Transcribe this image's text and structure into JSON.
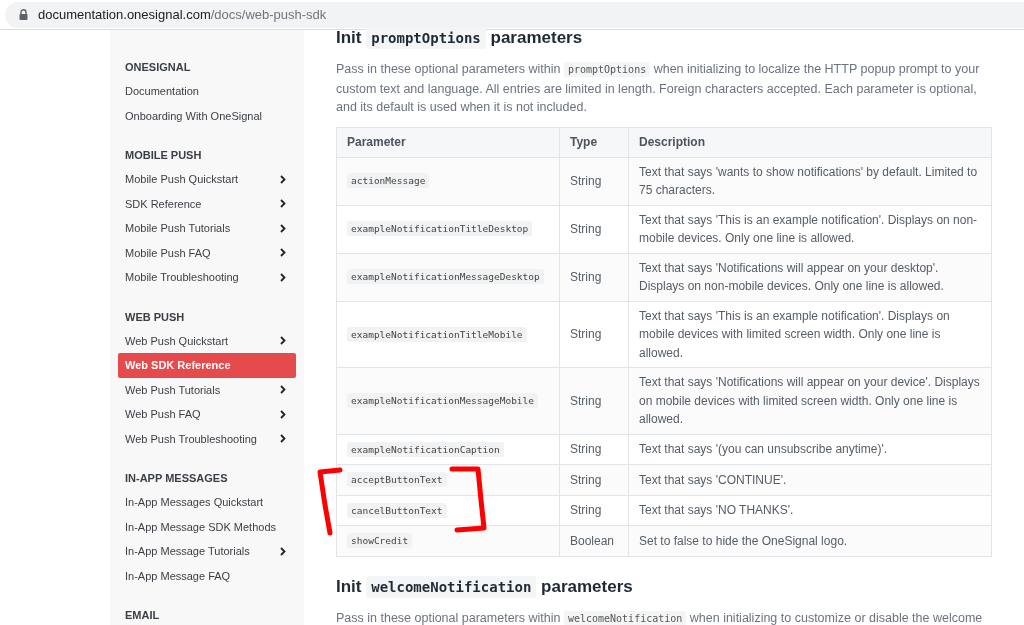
{
  "browser": {
    "url_host": "documentation.onesignal.com",
    "url_path": "/docs/web-push-sdk"
  },
  "sidebar": {
    "groups": [
      {
        "title": "ONESIGNAL",
        "items": [
          {
            "label": "Documentation",
            "has_submenu": false,
            "selected": false
          },
          {
            "label": "Onboarding With OneSignal",
            "has_submenu": false,
            "selected": false
          }
        ]
      },
      {
        "title": "MOBILE PUSH",
        "items": [
          {
            "label": "Mobile Push Quickstart",
            "has_submenu": true,
            "selected": false
          },
          {
            "label": "SDK Reference",
            "has_submenu": true,
            "selected": false
          },
          {
            "label": "Mobile Push Tutorials",
            "has_submenu": true,
            "selected": false
          },
          {
            "label": "Mobile Push FAQ",
            "has_submenu": true,
            "selected": false
          },
          {
            "label": "Mobile Troubleshooting",
            "has_submenu": true,
            "selected": false
          }
        ]
      },
      {
        "title": "WEB PUSH",
        "items": [
          {
            "label": "Web Push Quickstart",
            "has_submenu": true,
            "selected": false
          },
          {
            "label": "Web SDK Reference",
            "has_submenu": false,
            "selected": true
          },
          {
            "label": "Web Push Tutorials",
            "has_submenu": true,
            "selected": false
          },
          {
            "label": "Web Push FAQ",
            "has_submenu": true,
            "selected": false
          },
          {
            "label": "Web Push Troubleshooting",
            "has_submenu": true,
            "selected": false
          }
        ]
      },
      {
        "title": "IN-APP MESSAGES",
        "items": [
          {
            "label": "In-App Messages Quickstart",
            "has_submenu": false,
            "selected": false
          },
          {
            "label": "In-App Message SDK Methods",
            "has_submenu": false,
            "selected": false
          },
          {
            "label": "In-App Message Tutorials",
            "has_submenu": true,
            "selected": false
          },
          {
            "label": "In-App Message FAQ",
            "has_submenu": false,
            "selected": false
          }
        ]
      },
      {
        "title": "EMAIL"
      }
    ]
  },
  "content": {
    "section_1": {
      "heading": {
        "before": "Init",
        "code": "promptOptions",
        "after": "parameters"
      },
      "intro": {
        "before": "Pass in these optional parameters within",
        "code": "promptOptions",
        "after": "when initializing to localize the HTTP popup prompt to your custom text and language. All entries are limited in length. Foreign characters accepted. Each parameter is optional, and its default is used when it is not included."
      },
      "table": {
        "columns": [
          "Parameter",
          "Type",
          "Description"
        ],
        "rows": [
          {
            "parameter": "actionMessage",
            "type": "String",
            "description": "Text that says 'wants to show notifications' by default. Limited to 75 characters."
          },
          {
            "parameter": "exampleNotificationTitleDesktop",
            "type": "String",
            "description": "Text that says 'This is an example notification'. Displays on non-mobile devices. Only one line is allowed."
          },
          {
            "parameter": "exampleNotificationMessageDesktop",
            "type": "String",
            "description": "Text that says 'Notifications will appear on your desktop'. Displays on non-mobile devices. Only one line is allowed."
          },
          {
            "parameter": "exampleNotificationTitleMobile",
            "type": "String",
            "description": "Text that says 'This is an example notification'. Displays on mobile devices with limited screen width. Only one line is allowed."
          },
          {
            "parameter": "exampleNotificationMessageMobile",
            "type": "String",
            "description": "Text that says 'Notifications will appear on your device'. Displays on mobile devices with limited screen width. Only one line is allowed."
          },
          {
            "parameter": "exampleNotificationCaption",
            "type": "String",
            "description": "Text that says '(you can unsubscribe anytime)'."
          },
          {
            "parameter": "acceptButtonText",
            "type": "String",
            "description": "Text that says 'CONTINUE'."
          },
          {
            "parameter": "cancelButtonText",
            "type": "String",
            "description": "Text that says 'NO THANKS'."
          },
          {
            "parameter": "showCredit",
            "type": "Boolean",
            "description": "Set to false to hide the OneSignal logo."
          }
        ]
      }
    },
    "section_2": {
      "heading": {
        "before": "Init",
        "code": "welcomeNotification",
        "after": "parameters"
      },
      "intro": {
        "before": "Pass in these optional parameters within",
        "code": "welcomeNotification",
        "after": "when initializing to customize or disable the welcome"
      }
    }
  }
}
